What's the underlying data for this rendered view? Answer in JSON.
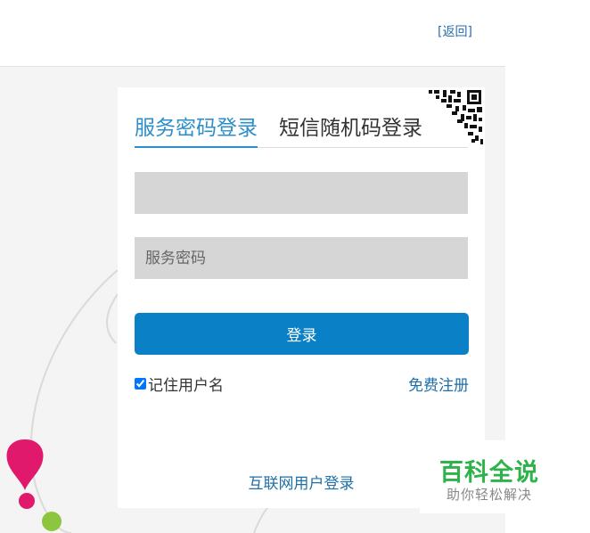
{
  "header": {
    "back_label": "[返回]"
  },
  "login": {
    "tabs": [
      "服务密码登录",
      "短信随机码登录"
    ],
    "username": {
      "value": "",
      "placeholder": ""
    },
    "password": {
      "placeholder": "服务密码"
    },
    "submit_label": "登录",
    "remember_label": "记住用户名",
    "remember_checked": true,
    "register_label": "免费注册",
    "internet_login_label": "互联网用户登录"
  },
  "watermark": {
    "title": "百科全说",
    "subtitle": "助你轻松解决"
  },
  "colors": {
    "accent": "#2d8ec9",
    "button": "#0a80c7",
    "link": "#1e6fa8",
    "input_bg": "#d6d6d6",
    "watermark_green": "#2fb24a",
    "pin_magenta": "#e0196d",
    "pin_green": "#8cc63e"
  },
  "icons": [
    "qr-code-icon",
    "map-pin-icon",
    "checkbox-icon"
  ]
}
